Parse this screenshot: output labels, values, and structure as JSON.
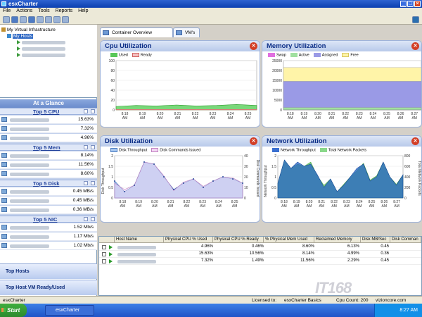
{
  "window": {
    "title": "esxCharter",
    "minimize": "_",
    "maximize": "□",
    "close": "×"
  },
  "menu": [
    "File",
    "Actions",
    "Tools",
    "Reports",
    "Help"
  ],
  "tree": {
    "root": "My Virtual Infrastructure",
    "hosts": "My Hosts"
  },
  "glance": {
    "title": "At a Glance",
    "sections": [
      {
        "title": "Top 5 CPU",
        "values": [
          "15.63%",
          "7.32%",
          "4.96%"
        ]
      },
      {
        "title": "Top 5 Mem",
        "values": [
          "8.14%",
          "11.56%",
          "8.60%"
        ]
      },
      {
        "title": "Top 5 Disk",
        "values": [
          "0.45 MB/s",
          "0.45 MB/s",
          "0.36 MB/s"
        ]
      },
      {
        "title": "Top 5 NIC",
        "values": [
          "1.52 Mb/s",
          "1.17 Mb/s",
          "1.02 Mb/s"
        ]
      }
    ]
  },
  "nav": {
    "top_hosts": "Top Hosts",
    "top_host_vm": "Top Host VM Ready/Used"
  },
  "tabs": [
    "Container Overview",
    "VM's"
  ],
  "panels": {
    "cpu": {
      "title": "Cpu Utilization",
      "legend": [
        "Used",
        "Ready"
      ],
      "colors": [
        "#58c858",
        "#e88a8a"
      ]
    },
    "mem": {
      "title": "Memory Utilization",
      "legend": [
        "Swap",
        "Active",
        "Assigned",
        "Free"
      ],
      "colors": [
        "#e070e0",
        "#a0e0a0",
        "#9a9ae6",
        "#fff4a8"
      ]
    },
    "disk": {
      "title": "Disk Utilization",
      "legend": [
        "Disk Throughput",
        "Disk Commands Issued"
      ],
      "ylabel_left": "Disk Throughput",
      "ylabel_right": "Disk Commands Issued"
    },
    "net": {
      "title": "Network Utilization",
      "legend": [
        "Network Throughput",
        "Total Network Packets"
      ],
      "ylabel_left": "Network Throughput",
      "ylabel_right": "Total Network Packets"
    }
  },
  "chart_data": [
    {
      "type": "area",
      "title": "Cpu Utilization",
      "categories": [
        "8:18 AM",
        "8:19 AM",
        "8:20 AM",
        "8:21 AM",
        "8:22 AM",
        "8:23 AM",
        "8:24 AM",
        "8:25 AM"
      ],
      "ylim": [
        0,
        100
      ],
      "yticks": [
        0,
        20,
        40,
        60,
        80,
        100
      ],
      "series": [
        {
          "name": "Used",
          "values": [
            7,
            9,
            8,
            10,
            8,
            9,
            11,
            9
          ]
        },
        {
          "name": "Ready",
          "values": [
            1,
            1,
            1,
            1,
            1,
            1,
            1,
            1
          ]
        }
      ]
    },
    {
      "type": "area",
      "title": "Memory Utilization",
      "categories": [
        "8:18 AM",
        "8:19 AM",
        "8:20 AM",
        "8:21 AM",
        "8:22 AM",
        "8:23 AM",
        "8:24 AM",
        "8:25 AM",
        "8:26 AM",
        "8:27 AM"
      ],
      "ylim": [
        0,
        25000
      ],
      "yticks": [
        0,
        5000,
        10000,
        15000,
        20000,
        25000
      ],
      "series": [
        {
          "name": "Swap",
          "values": [
            0,
            0,
            0,
            0,
            0,
            0,
            0,
            0,
            0,
            0
          ]
        },
        {
          "name": "Active",
          "values": [
            1200,
            1200,
            1200,
            1200,
            1200,
            1200,
            1200,
            1200,
            1200,
            1200
          ]
        },
        {
          "name": "Assigned",
          "values": [
            14500,
            14500,
            14500,
            14500,
            14500,
            14500,
            14500,
            14500,
            14500,
            14500
          ]
        },
        {
          "name": "Free",
          "values": [
            21500,
            21500,
            21500,
            21500,
            21500,
            21500,
            21500,
            21500,
            21500,
            21500
          ]
        }
      ]
    },
    {
      "type": "area",
      "title": "Disk Utilization",
      "categories": [
        "8:18 AM",
        "8:19 AM",
        "8:20 AM",
        "8:21 AM",
        "8:22 AM",
        "8:23 AM",
        "8:24 AM",
        "8:25 AM"
      ],
      "ylim": [
        0,
        2
      ],
      "yticks": [
        0,
        0.5,
        1,
        1.5,
        2
      ],
      "ylim_right": [
        0,
        40
      ],
      "yticks_right": [
        0,
        10,
        20,
        30,
        40
      ],
      "series": [
        {
          "name": "Disk Throughput",
          "values": [
            0.8,
            0.3,
            0.6,
            1.7,
            1.6,
            1.0,
            0.4,
            0.7,
            0.9,
            0.5,
            0.8,
            1.0,
            0.9,
            0.7
          ]
        },
        {
          "name": "Disk Commands Issued",
          "values": [
            14,
            8,
            12,
            34,
            32,
            21,
            7,
            15,
            18,
            11,
            16,
            20,
            19,
            14
          ]
        }
      ]
    },
    {
      "type": "area",
      "title": "Network Utilization",
      "categories": [
        "8:18 AM",
        "8:19 AM",
        "8:20 AM",
        "8:21 AM",
        "8:22 AM",
        "8:23 AM",
        "8:24 AM",
        "8:25 AM",
        "8:26 AM",
        "8:27 AM"
      ],
      "ylim": [
        0,
        2
      ],
      "yticks": [
        0,
        0.5,
        1,
        1.5,
        2
      ],
      "ylim_right": [
        0,
        800
      ],
      "yticks_right": [
        0,
        200,
        400,
        600,
        800
      ],
      "series": [
        {
          "name": "Network Throughput",
          "values": [
            0.7,
            1.8,
            1.4,
            1.7,
            1.5,
            1.6,
            1.1,
            0.5,
            0.9,
            0.3,
            0.6,
            1.0,
            1.4,
            1.6,
            0.8,
            1.0,
            1.7,
            1.0,
            0.6,
            1.1
          ]
        },
        {
          "name": "Total Network Packets",
          "values": [
            280,
            720,
            560,
            640,
            600,
            680,
            420,
            240,
            360,
            120,
            260,
            400,
            520,
            660,
            340,
            420,
            680,
            400,
            260,
            440
          ]
        }
      ]
    }
  ],
  "grid": {
    "headers": [
      "Host Name",
      "Physical CPU % Used",
      "Physical CPU % Ready",
      "% Physical Mem Used",
      "Reclaimed Memory",
      "Disk MB/Sec",
      "Disk Comman"
    ],
    "rows": [
      [
        "4.96%",
        "0.46%",
        "8.60%",
        "6.13%",
        "0.45"
      ],
      [
        "15.63%",
        "10.56%",
        "8.14%",
        "4.99%",
        "0.36"
      ],
      [
        "7.32%",
        "1.49%",
        "11.56%",
        "2.29%",
        "0.45"
      ]
    ]
  },
  "status": {
    "left": "esxCharter",
    "licensed": "Licensed to:",
    "edition": "esxCharter Basics",
    "cpu_count": "Cpu Count: 200",
    "site": "vizioncore.com"
  },
  "taskbar": {
    "start": "Start",
    "app": "esxCharter",
    "clock": "8:27 AM"
  },
  "watermark": "IT168"
}
